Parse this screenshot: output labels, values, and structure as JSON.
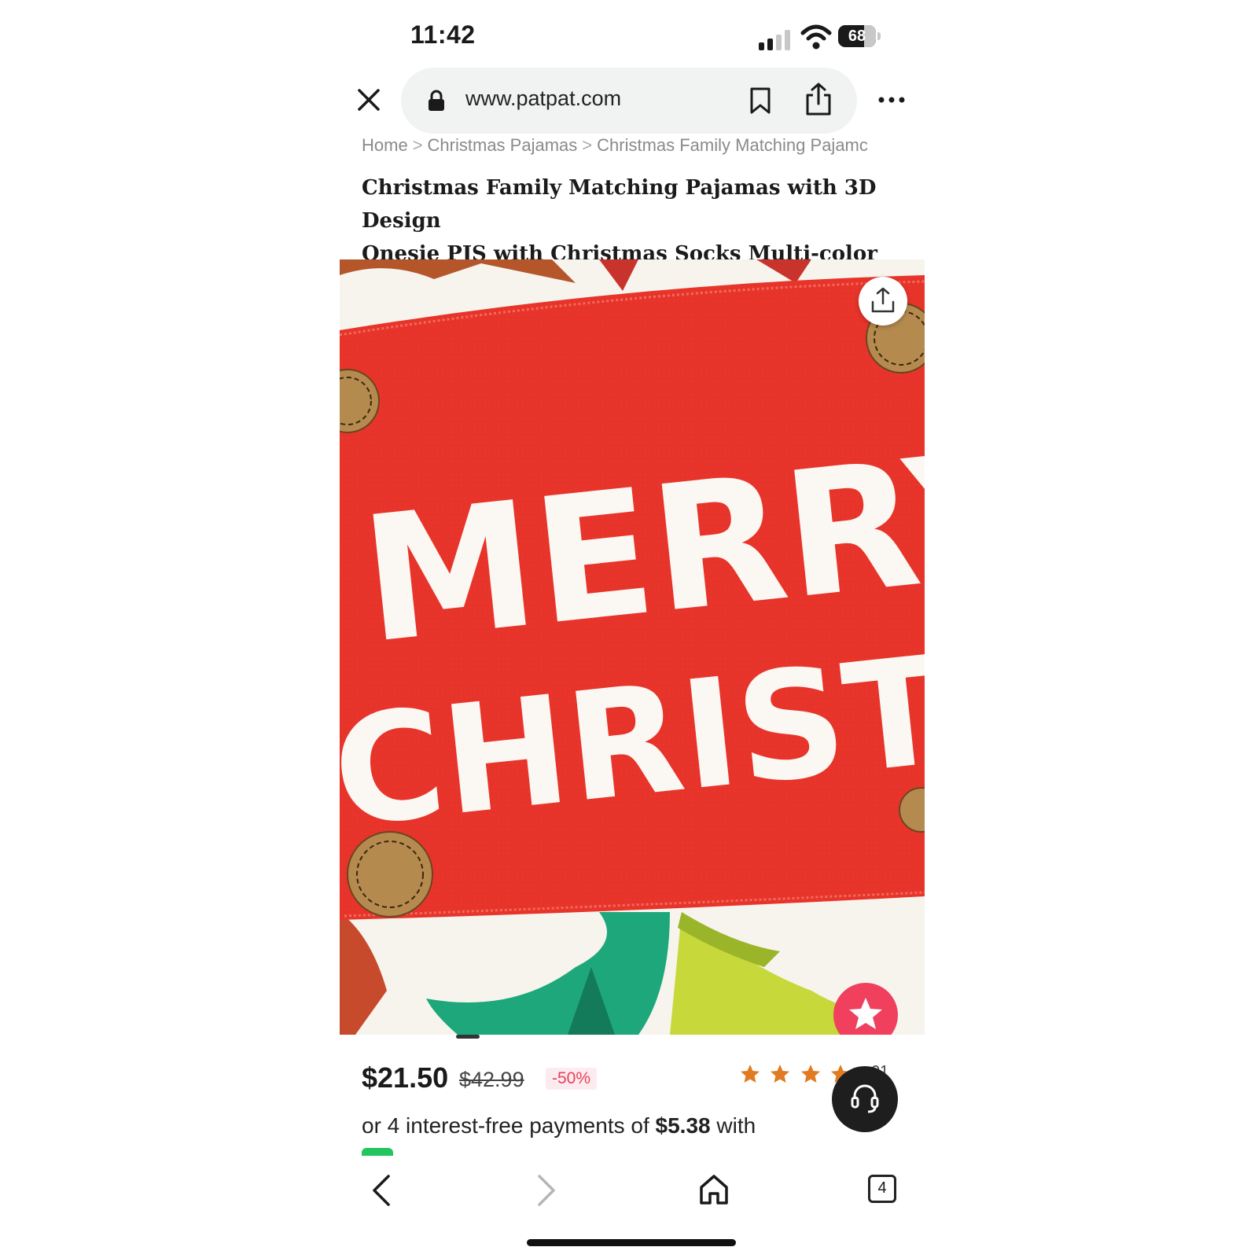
{
  "status_bar": {
    "time": "11:42",
    "battery": "68"
  },
  "browser": {
    "url": "www.patpat.com"
  },
  "breadcrumb": {
    "items": [
      "Home",
      "Christmas Pajamas",
      "Christmas Family Matching Pajamc"
    ],
    "separator": ">"
  },
  "product": {
    "title_line1": "Christmas Family Matching Pajamas with 3D Design",
    "title_line2": "Onesie PJS with Christmas Socks Multi-color",
    "image_text_line1": "MERRY",
    "image_text_line2": "CHRISTMA",
    "price": "$21.50",
    "original_price": "$42.99",
    "discount": "-50%",
    "rating": 4,
    "rating_count_fragment": "01",
    "installments_prefix": "or 4 interest-free payments of ",
    "installments_amount": "$5.38",
    "installments_suffix": " with"
  },
  "bottom_nav": {
    "tabs_count": "4"
  },
  "colors": {
    "accent_red": "#e8352b",
    "favorite_pink": "#f0405d",
    "star_orange": "#e07b22",
    "discount_red": "#e8405a"
  },
  "icons": [
    "close-icon",
    "lock-icon",
    "bookmark-icon",
    "share-icon",
    "more-icon",
    "star-icon",
    "headset-icon",
    "back-icon",
    "forward-icon",
    "home-icon",
    "tabs-icon"
  ]
}
